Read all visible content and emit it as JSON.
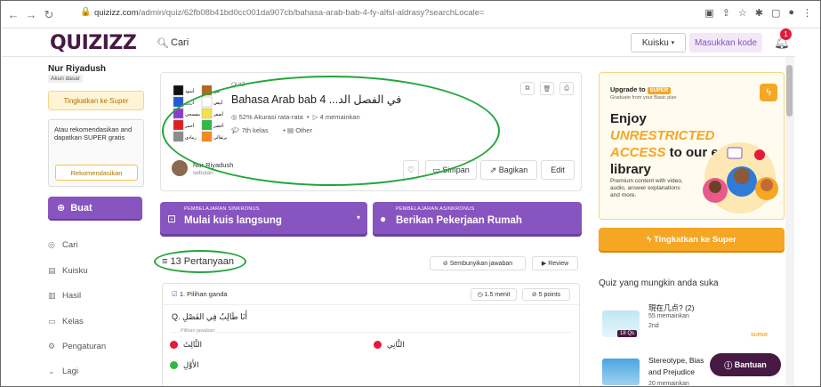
{
  "browser": {
    "url_host": "quizizz.com",
    "url_path": "/admin/quiz/62fb08b41bd0cc001da907cb/bahasa-arab-bab-4-fy-alfsl-aldrasy?searchLocale="
  },
  "header": {
    "logo": "QUIZIZZ",
    "search_placeholder": "Cari",
    "library_label": "Kuisku",
    "enter_code_label": "Masukkan kode",
    "notification_count": "1"
  },
  "sidebar": {
    "user_name": "Nur Riyadush",
    "account_type": "Akun dasar",
    "upgrade_label": "Tingkatkan ke Super",
    "recommend_text": "Atau rekomendasikan and dapatkan SUPER gratis",
    "recommend_label": "Rekomendasikan",
    "create_label": "Buat",
    "nav": [
      {
        "label": "Cari",
        "icon": "compass-icon"
      },
      {
        "label": "Kuisku",
        "icon": "library-icon"
      },
      {
        "label": "Hasil",
        "icon": "chart-icon"
      },
      {
        "label": "Kelas",
        "icon": "classes-icon"
      },
      {
        "label": "Pengaturan",
        "icon": "gear-icon"
      },
      {
        "label": "Lagi",
        "icon": "chevron-down-icon"
      }
    ]
  },
  "quiz": {
    "type_label": "QUIZ",
    "title": "Bahasa Arab bab 4 ...في الفصل الد",
    "accuracy": "52% Akurasi rata-rata",
    "plays": "4 memainkan",
    "grade": "7th kelas",
    "subject": "Other",
    "author": "Nur Riyadush",
    "author_time": "sebulan",
    "save_label": "Simpan",
    "share_label": "Bagikan",
    "edit_label": "Edit",
    "thumb_colors": [
      {
        "left": "#111111",
        "right": "#b5651d",
        "l1": "أسود",
        "l2": "بني"
      },
      {
        "left": "#1e5bd7",
        "right": "#ffffff",
        "l1": "أزرق",
        "l2": "أبيض"
      },
      {
        "left": "#8a3bd0",
        "right": "#f4e24a",
        "l1": "بنفسجي",
        "l2": "أصفر"
      },
      {
        "left": "#e02020",
        "right": "#2fb844",
        "l1": "أحمر",
        "l2": "أخضر"
      },
      {
        "left": "#8c8c8c",
        "right": "#f58a1f",
        "l1": "رمادي",
        "l2": "برتقالي"
      }
    ]
  },
  "actions": {
    "sync_small": "PEMBELAJARAN SINKRONUS",
    "sync_big": "Mulai kuis langsung",
    "async_small": "PEMBELAJARAN ASINKRONUS",
    "async_big": "Berikan Pekerjaan Rumah"
  },
  "questions": {
    "count_label": "13 Pertanyaan",
    "hide_label": "Sembunyikan jawaban",
    "review_label": "Review",
    "items": [
      {
        "type": "1. Pilihan ganda",
        "time": "1.5 menit",
        "points": "5 points",
        "text": "Q. أَنَا طَالِبٌ فِي الفَصْلِ",
        "choices_label": "Pilihan jawaban",
        "answers": [
          {
            "text": "الثَّالِثَ",
            "color": "#e21b3c"
          },
          {
            "text": "الثَّانِي",
            "color": "#e21b3c"
          },
          {
            "text": "الأَوَّلِ",
            "color": "#2fb844"
          }
        ]
      }
    ]
  },
  "promo": {
    "upgrade_to": "Upgrade to",
    "badge": "SUPER",
    "grad": "Graduate from your Basic plan",
    "headline_1": "Enjoy ",
    "headline_accent": "UNRESTRICTED ACCESS",
    "headline_2": " to our entire library",
    "premium": "Premium content with video, audio, answer explanations and more.",
    "upgrade_button": "Tingkatkan ke Super"
  },
  "recommend": {
    "heading": "Quiz yang mungkin anda suka",
    "items": [
      {
        "title": "現在几点? (2)",
        "plays": "55 memainkan",
        "grade": "2nd",
        "qs": "18 Qs",
        "badge": "SUPER"
      },
      {
        "title": "Stereotype, Bias and Prejudice",
        "plays": "20 memainkan"
      }
    ]
  },
  "help_label": "Bantuan"
}
